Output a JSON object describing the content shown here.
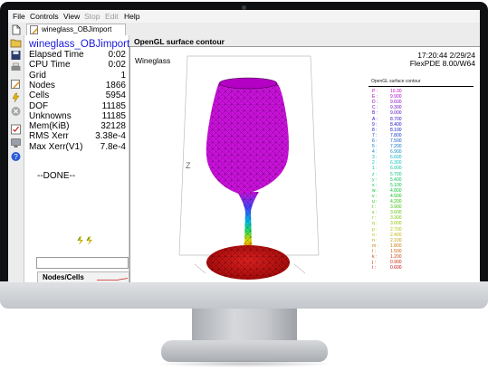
{
  "menu": [
    {
      "label": "File",
      "enabled": true
    },
    {
      "label": "Controls",
      "enabled": true
    },
    {
      "label": "View",
      "enabled": true
    },
    {
      "label": "Stop",
      "enabled": false
    },
    {
      "label": "Edit",
      "enabled": false
    },
    {
      "label": "Help",
      "enabled": true
    }
  ],
  "tab": {
    "label": "wineglass_OBJimport"
  },
  "stats": {
    "title": "wineglass_OBJimport",
    "rows": [
      {
        "key": "Elapsed Time",
        "value": "0:02"
      },
      {
        "key": "CPU Time",
        "value": "0:02"
      },
      {
        "key": "Grid",
        "value": "1"
      },
      {
        "key": "Nodes",
        "value": "1866"
      },
      {
        "key": "Cells",
        "value": "5954"
      },
      {
        "key": "DOF",
        "value": "11185"
      },
      {
        "key": "Unknowns",
        "value": "11185"
      },
      {
        "key": "Mem(KiB)",
        "value": "32128"
      },
      {
        "key": "RMS Xerr",
        "value": "3.38e-4"
      },
      {
        "key": "Max Xerr(V1)",
        "value": "7.8e-4"
      }
    ],
    "status": "--DONE--",
    "nodes_tab": "Nodes/Cells"
  },
  "plot": {
    "panel_title": "OpenGL surface contour",
    "name": "Wineglass",
    "timestamp": "17:20:44 2/29/24",
    "version": "FlexPDE 8.00/W64",
    "axis_z": "Z",
    "legend_title": "OpenGL surface contour",
    "legend": [
      {
        "key": "P :",
        "value": "10.30"
      },
      {
        "key": "E :",
        "value": "9.900"
      },
      {
        "key": "D :",
        "value": "9.600"
      },
      {
        "key": "C :",
        "value": "9.300"
      },
      {
        "key": "B :",
        "value": "9.000"
      },
      {
        "key": "A :",
        "value": "8.700"
      },
      {
        "key": "9 :",
        "value": "8.400"
      },
      {
        "key": "8 :",
        "value": "8.100"
      },
      {
        "key": "7 :",
        "value": "7.800"
      },
      {
        "key": "6 :",
        "value": "7.500"
      },
      {
        "key": "5 :",
        "value": "7.200"
      },
      {
        "key": "4 :",
        "value": "6.900"
      },
      {
        "key": "3 :",
        "value": "6.600"
      },
      {
        "key": "2 :",
        "value": "6.300"
      },
      {
        "key": "1 :",
        "value": "6.000"
      },
      {
        "key": "z :",
        "value": "5.700"
      },
      {
        "key": "y :",
        "value": "5.400"
      },
      {
        "key": "x :",
        "value": "5.100"
      },
      {
        "key": "w :",
        "value": "4.800"
      },
      {
        "key": "v :",
        "value": "4.500"
      },
      {
        "key": "u :",
        "value": "4.200"
      },
      {
        "key": "t :",
        "value": "3.900"
      },
      {
        "key": "s :",
        "value": "3.600"
      },
      {
        "key": "r :",
        "value": "3.300"
      },
      {
        "key": "q :",
        "value": "3.000"
      },
      {
        "key": "p :",
        "value": "2.700"
      },
      {
        "key": "o :",
        "value": "2.400"
      },
      {
        "key": "n :",
        "value": "2.100"
      },
      {
        "key": "m :",
        "value": "1.800"
      },
      {
        "key": "l :",
        "value": "1.500"
      },
      {
        "key": "k :",
        "value": "1.200"
      },
      {
        "key": "j :",
        "value": "0.900"
      },
      {
        "key": "i :",
        "value": "0.600"
      }
    ]
  },
  "icons": [
    "new-file-icon",
    "open-folder-icon",
    "save-icon",
    "print-icon",
    "edit-icon",
    "run-icon",
    "stop-icon",
    "checklist-icon",
    "screen-icon",
    "help-icon"
  ],
  "colors": {
    "bowl": "#cc11dd",
    "base": "#c40c0c",
    "title": "#1a1adc"
  }
}
